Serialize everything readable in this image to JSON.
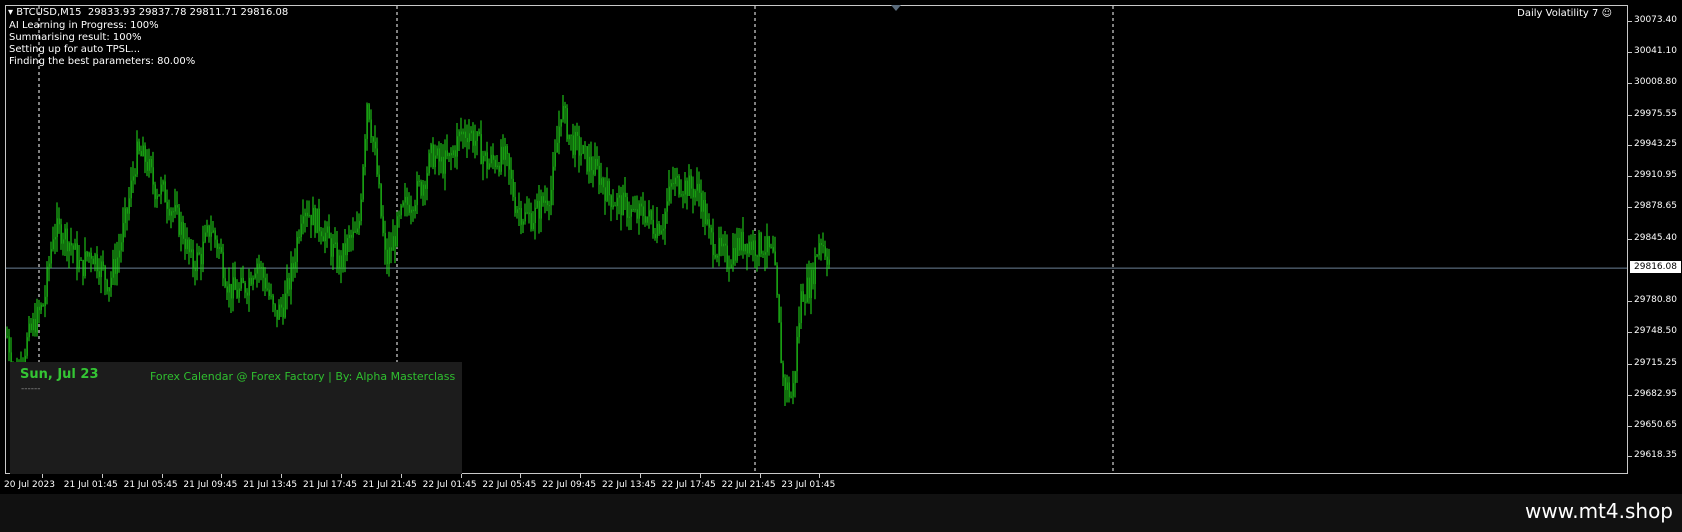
{
  "header": {
    "symbol": "BTCUSD,M15",
    "ohlc": "29833.93 29837.78 29811.71 29816.08"
  },
  "status_lines": [
    "AI Learning in Progress: 100%",
    "Summarising result: 100%",
    "Setting up for auto TPSL...",
    "Finding the best parameters: 80.00%"
  ],
  "indicator": {
    "label": "Daily Volatility 7",
    "icon": "smiley-icon"
  },
  "price_axis": {
    "labels": [
      "30073.40",
      "30041.10",
      "30008.80",
      "29975.55",
      "29943.25",
      "29910.95",
      "29878.65",
      "29845.40",
      "29780.80",
      "29748.50",
      "29715.25",
      "29682.95",
      "29650.65",
      "29618.35"
    ],
    "current_price": "29816.08",
    "min": 29600,
    "max": 30090
  },
  "time_axis": {
    "labels": [
      "20 Jul 2023",
      "21 Jul 01:45",
      "21 Jul 05:45",
      "21 Jul 09:45",
      "21 Jul 13:45",
      "21 Jul 17:45",
      "21 Jul 21:45",
      "22 Jul 01:45",
      "22 Jul 05:45",
      "22 Jul 09:45",
      "22 Jul 13:45",
      "22 Jul 17:45",
      "22 Jul 21:45",
      "23 Jul 01:45"
    ]
  },
  "calendar": {
    "date": "Sun, Jul 23",
    "dashes": "------",
    "source": "Forex Calendar @ Forex Factory | By: Alpha Masterclass"
  },
  "watermark": "www.mt4.shop",
  "colors": {
    "candle": "#22e01a",
    "price_line": "#6b7f96",
    "grid_dash": "#ffffff",
    "background": "#000000"
  },
  "chart_data": {
    "type": "candlestick",
    "symbol": "BTCUSD",
    "timeframe": "M15",
    "ylim": [
      29600,
      30090
    ],
    "close_path": [
      29745,
      29700,
      29735,
      29760,
      29780,
      29855,
      29855,
      29840,
      29815,
      29835,
      29820,
      29800,
      29830,
      29875,
      29935,
      29930,
      29900,
      29895,
      29875,
      29855,
      29820,
      29830,
      29860,
      29835,
      29795,
      29790,
      29800,
      29825,
      29800,
      29765,
      29780,
      29820,
      29885,
      29870,
      29860,
      29840,
      29820,
      29845,
      29850,
      29995,
      29920,
      29820,
      29850,
      29880,
      29890,
      29905,
      29935,
      29925,
      29930,
      29955,
      29960,
      29945,
      29925,
      29930,
      29930,
      29885,
      29870,
      29870,
      29885,
      29900,
      29985,
      29950,
      29940,
      29925,
      29915,
      29895,
      29885,
      29880,
      29870,
      29875,
      29860,
      29865,
      29905,
      29905,
      29900,
      29895,
      29850,
      29835,
      29825,
      29840,
      29845,
      29840,
      29840,
      29825,
      29700,
      29680,
      29790,
      29800,
      29850,
      29825
    ]
  }
}
